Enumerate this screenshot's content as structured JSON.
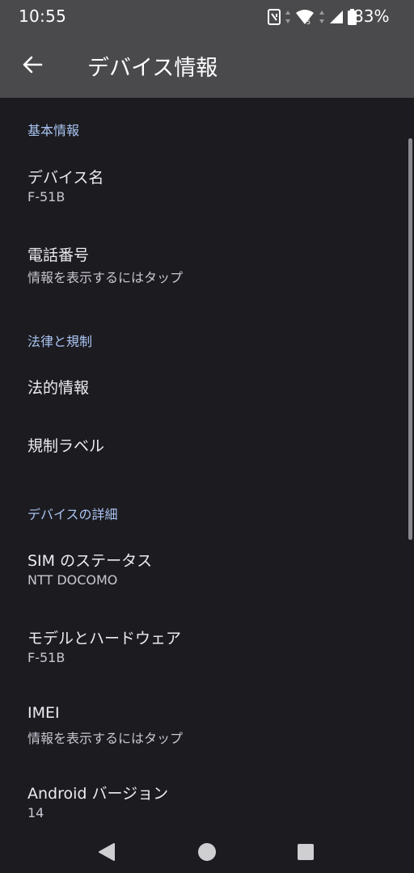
{
  "status_bar": {
    "time": "10:55",
    "battery": "83%",
    "icons": [
      "nfc-icon",
      "data-arrows-icon",
      "wifi-icon",
      "cell-signal-icon",
      "battery-icon"
    ]
  },
  "app_bar": {
    "title": "デバイス情報",
    "back_icon": "arrow-back-icon"
  },
  "sections": {
    "basic": {
      "header": "基本情報",
      "device_name": {
        "title": "デバイス名",
        "summary": "F-51B"
      },
      "phone_number": {
        "title": "電話番号",
        "summary": "情報を表示するにはタップ"
      }
    },
    "legal": {
      "header": "法律と規制",
      "legal_info": {
        "title": "法的情報"
      },
      "regulatory_labels": {
        "title": "規制ラベル"
      }
    },
    "details": {
      "header": "デバイスの詳細",
      "sim_status": {
        "title": "SIM のステータス",
        "summary": "NTT DOCOMO"
      },
      "model_hardware": {
        "title": "モデルとハードウェア",
        "summary": "F-51B"
      },
      "imei": {
        "title": "IMEI",
        "summary": "情報を表示するにはタップ"
      },
      "android_version": {
        "title": "Android バージョン",
        "summary": "14"
      }
    }
  },
  "colors": {
    "background": "#1c1b20",
    "app_bar": "#4a4a4d",
    "section_header": "#a9c4f2",
    "title_text": "#ecebef",
    "summary_text": "#c9c6cf"
  },
  "nav_bar": {
    "icons": [
      "back-triangle-icon",
      "home-circle-icon",
      "recents-square-icon"
    ]
  }
}
